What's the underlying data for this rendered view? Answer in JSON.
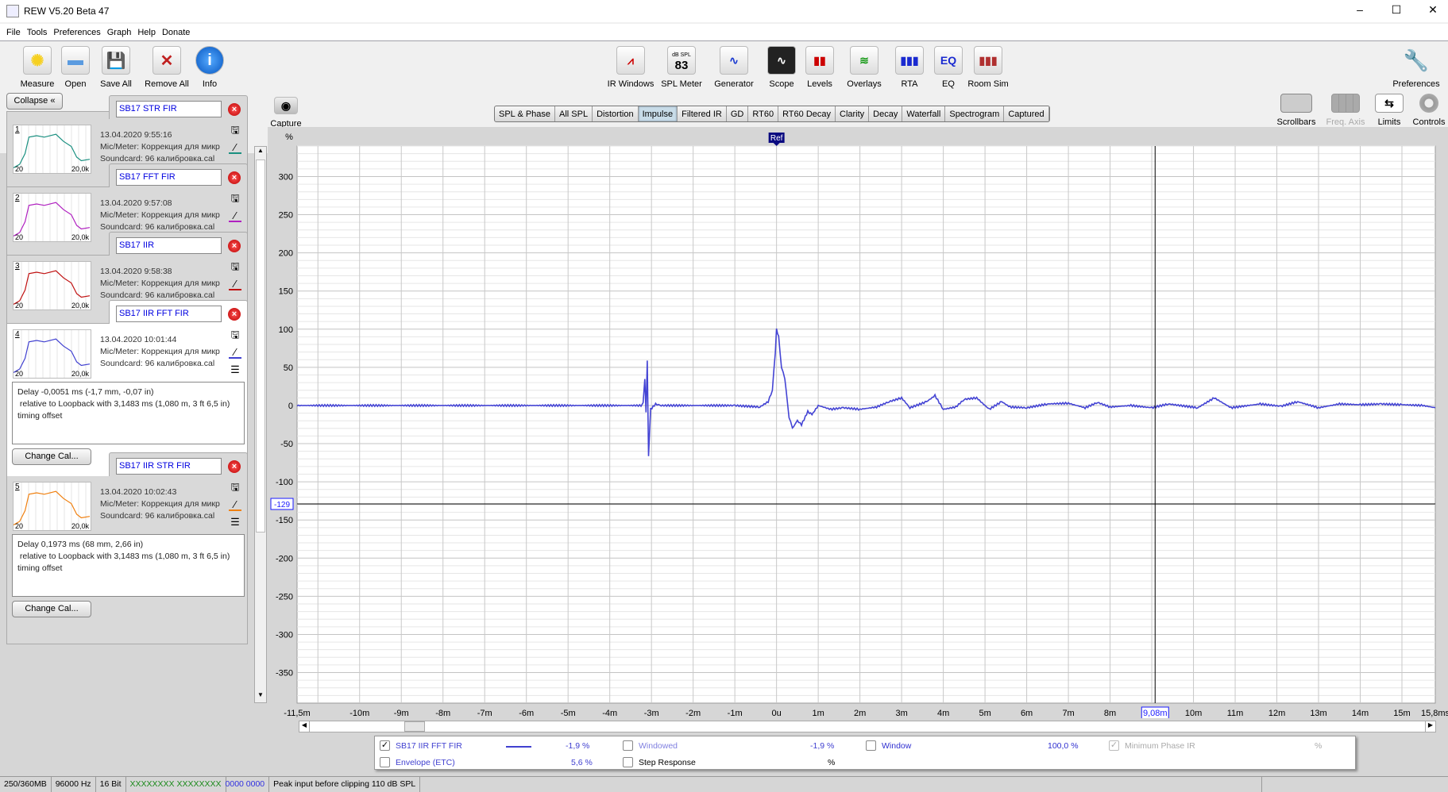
{
  "window": {
    "title": "REW V5.20 Beta 47",
    "minimize": "–",
    "maximize": "☐",
    "close": "✕"
  },
  "menu": [
    "File",
    "Tools",
    "Preferences",
    "Graph",
    "Help",
    "Donate"
  ],
  "toolbar_left": [
    {
      "label": "Measure",
      "icon": "measure-icon"
    },
    {
      "label": "Open",
      "icon": "folder-icon"
    },
    {
      "label": "Save All",
      "icon": "save-icon"
    },
    {
      "label": "Remove All",
      "icon": "remove-icon"
    },
    {
      "label": "Info",
      "icon": "info-icon"
    }
  ],
  "toolbar_center": [
    {
      "label": "IR Windows",
      "glyph": "⩘"
    },
    {
      "label": "SPL Meter",
      "glyph": "83",
      "sub": "dB SPL"
    },
    {
      "label": "Generator",
      "glyph": "∿"
    },
    {
      "label": "Scope",
      "glyph": "∿"
    },
    {
      "label": "Levels",
      "glyph": "▮▮"
    },
    {
      "label": "Overlays",
      "glyph": "≋"
    },
    {
      "label": "RTA",
      "glyph": "▮▮▮"
    },
    {
      "label": "EQ",
      "glyph": "EQ"
    },
    {
      "label": "Room Sim",
      "glyph": "▮▮▮"
    }
  ],
  "toolbar_right": {
    "preferences": "Preferences",
    "scrollbars": "Scrollbars",
    "freq_axis": "Freq. Axis",
    "limits": "Limits",
    "controls": "Controls",
    "capture": "Capture"
  },
  "tabs": [
    "SPL & Phase",
    "All SPL",
    "Distortion",
    "Impulse",
    "Filtered IR",
    "GD",
    "RT60",
    "RT60 Decay",
    "Clarity",
    "Decay",
    "Waterfall",
    "Spectrogram",
    "Captured"
  ],
  "active_tab": "Impulse",
  "collapse_label": "Collapse",
  "measurements": [
    {
      "num": "1",
      "name": "SB17 STR FIR",
      "date": "13.04.2020 9:55:16",
      "mic": "Mic/Meter: Коррекция для микр",
      "soundcard": "Soundcard: 96 калибровка.cal",
      "color": "#1a9080",
      "fmin": "20",
      "fmax": "20,0k"
    },
    {
      "num": "2",
      "name": "SB17 FFT FIR",
      "date": "13.04.2020 9:57:08",
      "mic": "Mic/Meter: Коррекция для микр",
      "soundcard": "Soundcard: 96 калибровка.cal",
      "color": "#b020c0",
      "fmin": "20",
      "fmax": "20,0k"
    },
    {
      "num": "3",
      "name": "SB17 IIR",
      "date": "13.04.2020 9:58:38",
      "mic": "Mic/Meter: Коррекция для микр",
      "soundcard": "Soundcard: 96 калибровка.cal",
      "color": "#c01010",
      "fmin": "20",
      "fmax": "20,0k"
    },
    {
      "num": "4",
      "name": "SB17 IIR FFT FIR",
      "date": "13.04.2020 10:01:44",
      "mic": "Mic/Meter: Коррекция для микр",
      "soundcard": "Soundcard: 96 калибровка.cal",
      "color": "#4040d0",
      "fmin": "20",
      "fmax": "20,0k",
      "delay": "Delay -0,0051 ms (-1,7 mm, -0,07 in)\n relative to Loopback with 3,1483 ms (1,080 m, 3 ft 6,5 in)\ntiming offset",
      "change_cal": "Change Cal..."
    },
    {
      "num": "5",
      "name": "SB17 IIR STR FIR",
      "date": "13.04.2020 10:02:43",
      "mic": "Mic/Meter: Коррекция для микр",
      "soundcard": "Soundcard: 96 калибровка.cal",
      "color": "#f08010",
      "fmin": "20",
      "fmax": "20,0k",
      "delay": "Delay 0,1973 ms (68 mm, 2,66 in)\n relative to Loopback with 3,1483 ms (1,080 m, 3 ft 6,5 in)\ntiming offset",
      "change_cal": "Change Cal..."
    }
  ],
  "chart_data": {
    "type": "line",
    "ylabel": "%",
    "xlim": [
      -11.5,
      15.8
    ],
    "ylim": [
      -390,
      340
    ],
    "yticks": [
      300,
      250,
      200,
      150,
      100,
      50,
      0,
      -50,
      -100,
      -150,
      -200,
      -250,
      -300,
      -350
    ],
    "xticks": [
      {
        "v": -11.5,
        "t": "-11,5m"
      },
      {
        "v": -10,
        "t": "-10m"
      },
      {
        "v": -9,
        "t": "-9m"
      },
      {
        "v": -8,
        "t": "-8m"
      },
      {
        "v": -7,
        "t": "-7m"
      },
      {
        "v": -6,
        "t": "-6m"
      },
      {
        "v": -5,
        "t": "-5m"
      },
      {
        "v": -4,
        "t": "-4m"
      },
      {
        "v": -3,
        "t": "-3m"
      },
      {
        "v": -2,
        "t": "-2m"
      },
      {
        "v": -1,
        "t": "-1m"
      },
      {
        "v": 0,
        "t": "0u"
      },
      {
        "v": 1,
        "t": "1m"
      },
      {
        "v": 2,
        "t": "2m"
      },
      {
        "v": 3,
        "t": "3m"
      },
      {
        "v": 4,
        "t": "4m"
      },
      {
        "v": 5,
        "t": "5m"
      },
      {
        "v": 6,
        "t": "6m"
      },
      {
        "v": 7,
        "t": "7m"
      },
      {
        "v": 8,
        "t": "8m"
      },
      {
        "v": 10,
        "t": "10m"
      },
      {
        "v": 11,
        "t": "11m"
      },
      {
        "v": 12,
        "t": "12m"
      },
      {
        "v": 13,
        "t": "13m"
      },
      {
        "v": 14,
        "t": "14m"
      },
      {
        "v": 15,
        "t": "15m"
      },
      {
        "v": 15.8,
        "t": "15,8ms"
      }
    ],
    "ref_marker": {
      "x": 0,
      "label": "Ref"
    },
    "cursor": {
      "x": 9.08,
      "x_label": "9,08m",
      "y": -129,
      "y_label": "-129"
    },
    "series": [
      {
        "name": "SB17 IIR FFT FIR",
        "color": "#4444d4",
        "points": [
          [
            -11.5,
            0
          ],
          [
            -3.25,
            0
          ],
          [
            -3.2,
            5
          ],
          [
            -3.16,
            35
          ],
          [
            -3.13,
            -10
          ],
          [
            -3.1,
            60
          ],
          [
            -3.07,
            -67
          ],
          [
            -3.02,
            -5
          ],
          [
            -2.9,
            2
          ],
          [
            -2.8,
            0
          ],
          [
            -1,
            0
          ],
          [
            -0.4,
            -2
          ],
          [
            -0.2,
            5
          ],
          [
            -0.1,
            20
          ],
          [
            -0.03,
            70
          ],
          [
            0,
            100
          ],
          [
            0.05,
            90
          ],
          [
            0.12,
            50
          ],
          [
            0.2,
            35
          ],
          [
            0.3,
            -15
          ],
          [
            0.38,
            -30
          ],
          [
            0.5,
            -20
          ],
          [
            0.6,
            -25
          ],
          [
            0.75,
            -8
          ],
          [
            0.85,
            -12
          ],
          [
            1,
            0
          ],
          [
            1.3,
            -5
          ],
          [
            1.6,
            -3
          ],
          [
            2,
            -5
          ],
          [
            2.4,
            -2
          ],
          [
            2.7,
            5
          ],
          [
            3.0,
            10
          ],
          [
            3.2,
            -3
          ],
          [
            3.6,
            5
          ],
          [
            3.8,
            13
          ],
          [
            4.0,
            -5
          ],
          [
            4.3,
            -2
          ],
          [
            4.5,
            8
          ],
          [
            4.8,
            10
          ],
          [
            5.1,
            -5
          ],
          [
            5.4,
            5
          ],
          [
            5.6,
            -2
          ],
          [
            6.0,
            -3
          ],
          [
            6.5,
            2
          ],
          [
            7.0,
            3
          ],
          [
            7.4,
            -3
          ],
          [
            7.7,
            4
          ],
          [
            8.0,
            -2
          ],
          [
            8.5,
            0
          ],
          [
            9,
            -3
          ],
          [
            9.4,
            2
          ],
          [
            10.1,
            -3
          ],
          [
            10.5,
            10
          ],
          [
            10.9,
            -3
          ],
          [
            11.6,
            2
          ],
          [
            12.1,
            -1
          ],
          [
            12.5,
            5
          ],
          [
            13.0,
            -3
          ],
          [
            13.5,
            2
          ],
          [
            14,
            1
          ],
          [
            14.5,
            2
          ],
          [
            15,
            1
          ],
          [
            15.5,
            0
          ],
          [
            15.8,
            -3
          ]
        ]
      }
    ]
  },
  "legend": {
    "row1": [
      {
        "label": "SB17 IIR FFT FIR",
        "value": "-1,9 %",
        "checked": "✓"
      },
      {
        "label": "Windowed",
        "value": "-1,9 %"
      },
      {
        "label": "Window",
        "value": "100,0 %"
      },
      {
        "label": "Minimum Phase IR",
        "value": "%",
        "checked": "✓"
      }
    ],
    "row2": [
      {
        "label": "Envelope (ETC)",
        "value": "5,6 %"
      },
      {
        "label": "Step Response",
        "value": "%"
      }
    ]
  },
  "status": [
    "250/360MB",
    "96000 Hz",
    "16 Bit",
    "XXXXXXXX  XXXXXXXX",
    "0000 0000",
    "Peak input before clipping 110 dB SPL"
  ]
}
